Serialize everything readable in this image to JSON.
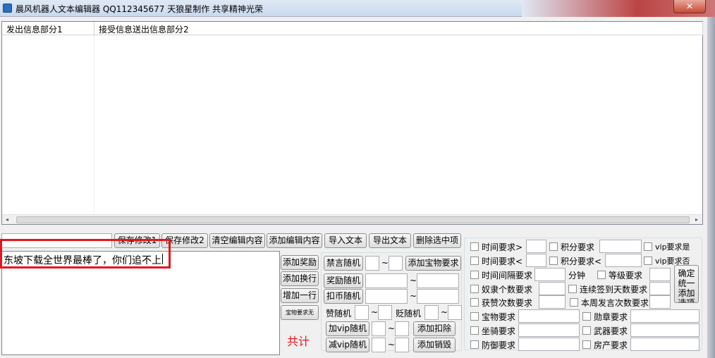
{
  "window": {
    "title": "晨风机器人文本编辑器    QQ112345677 天狼星制作   共享精神光荣",
    "close_glyph": "✕"
  },
  "list": {
    "col1": "发出信息部分1",
    "col2": "接受信息送出信息部分2"
  },
  "scroll": {
    "left": "◂",
    "right": "▸"
  },
  "toolbar": {
    "save1": "保存修改1",
    "save2": "保存修改2",
    "clear": "清空编辑内容",
    "add_content": "添加编辑内容",
    "import": "导入文本",
    "export": "导出文本",
    "delete": "删除选中项"
  },
  "editor": {
    "text": "东坡下载全世界最棒了，你们追不上",
    "total_label": "共计"
  },
  "side_buttons": {
    "add_reward": "添加奖励",
    "add_newline": "添加换行",
    "add_line": "增加一行",
    "treasure_none": "宝物要求无"
  },
  "random": {
    "ban": "禁言随机",
    "reward": "奖励随机",
    "deduct_coin": "扣币随机",
    "treasure_req": "添加宝物要求",
    "praise": "赞随机",
    "demote": "贬随机",
    "add_vip": "加vip随机",
    "sub_vip": "减vip随机",
    "add_deduct": "添加扣除",
    "add_destroy": "添加销毁",
    "tilde": "~"
  },
  "conditions": {
    "time_gt": "时间要求>",
    "points_req": "积分要求",
    "vip_yes": "vip要求是",
    "time_lt": "时间要求<",
    "points_lt": "积分要求<",
    "vip_no": "vip要求否",
    "interval": "时间间隔要求",
    "minutes": "分钟",
    "level_req": "等级要求",
    "confirm_btn": "确定统一添加选项",
    "slave_count": "奴隶个数要求",
    "signin_days": "连续签到天数要求",
    "praise_count": "获赞次数要求",
    "week_posts": "本周发言次数要求",
    "treasure": "宝物要求",
    "medal": "勋章要求",
    "mount": "坐骑要求",
    "weapon": "武器要求",
    "defense": "防御要求",
    "property": "房产要求"
  }
}
